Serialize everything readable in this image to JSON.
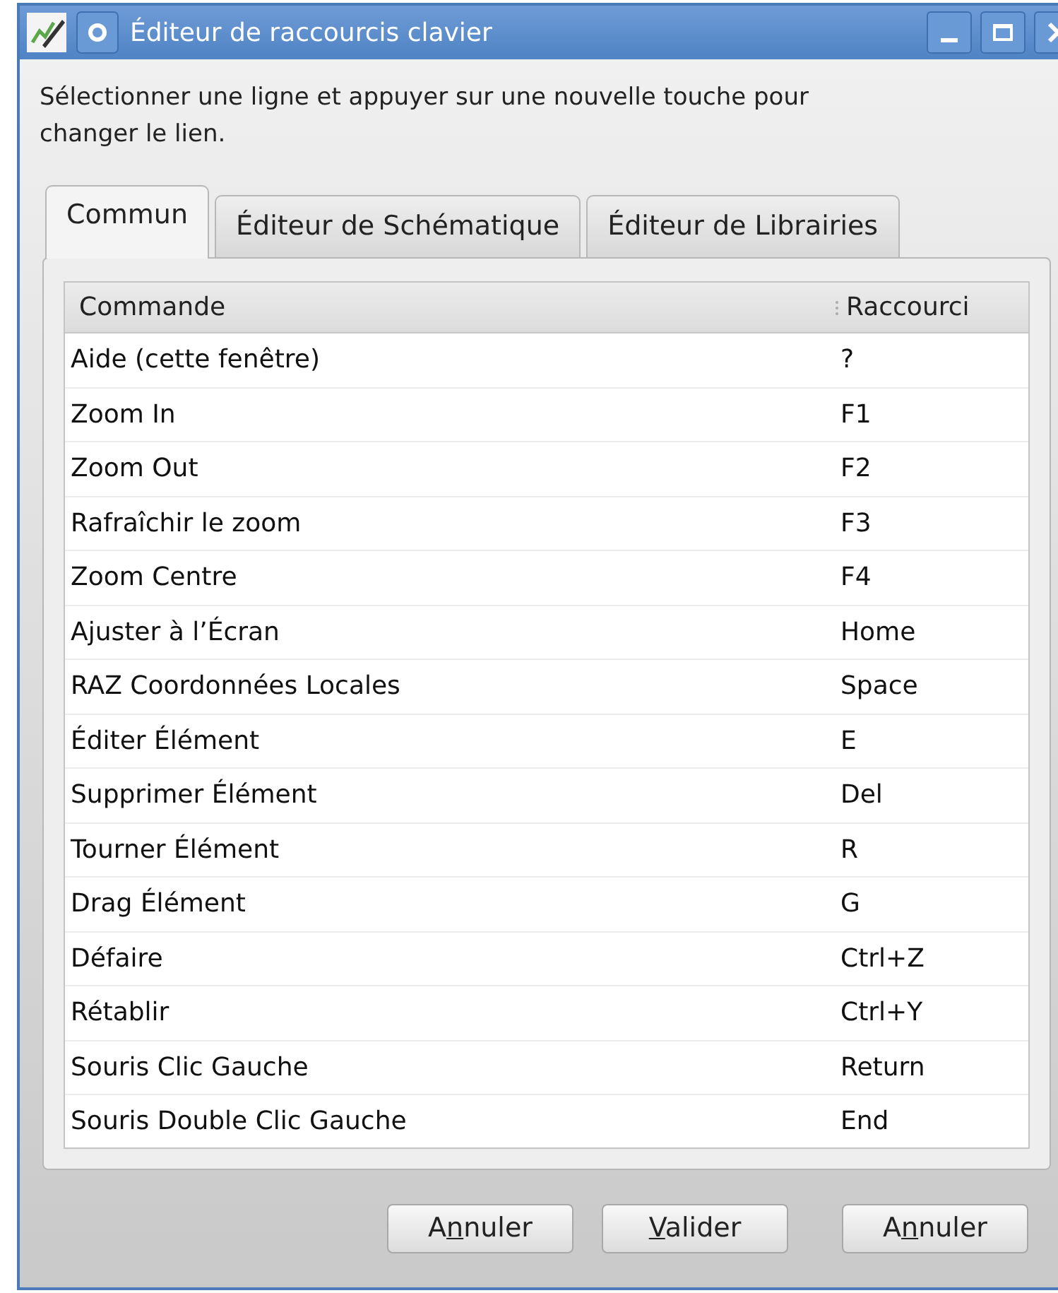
{
  "window": {
    "title": "Éditeur de raccourcis clavier"
  },
  "instructions": "Sélectionner une ligne et appuyer sur une nouvelle touche pour changer le lien.",
  "tabs": [
    {
      "label": "Commun",
      "selected": true
    },
    {
      "label": "Éditeur de Schématique",
      "selected": false
    },
    {
      "label": "Éditeur de Librairies",
      "selected": false
    }
  ],
  "table": {
    "columns": [
      "Commande",
      "Raccourci"
    ],
    "rows": [
      [
        "Aide (cette fenêtre)",
        "?"
      ],
      [
        "Zoom In",
        "F1"
      ],
      [
        "Zoom Out",
        "F2"
      ],
      [
        "Rafraîchir le zoom",
        "F3"
      ],
      [
        "Zoom Centre",
        "F4"
      ],
      [
        "Ajuster à l’Écran",
        "Home"
      ],
      [
        "RAZ Coordonnées Locales",
        "Space"
      ],
      [
        "Éditer Élément",
        "E"
      ],
      [
        "Supprimer Élément",
        "Del"
      ],
      [
        "Tourner Élément",
        "R"
      ],
      [
        "Drag Élément",
        "G"
      ],
      [
        "Défaire",
        "Ctrl+Z"
      ],
      [
        "Rétablir",
        "Ctrl+Y"
      ],
      [
        "Souris Clic Gauche",
        "Return"
      ],
      [
        "Souris Double Clic Gauche",
        "End"
      ]
    ]
  },
  "buttons": [
    {
      "parts": [
        "A",
        "n",
        "nuler"
      ]
    },
    {
      "parts": [
        "V",
        "alider"
      ]
    },
    {
      "parts": [
        "A",
        "n",
        "nuler"
      ]
    }
  ]
}
